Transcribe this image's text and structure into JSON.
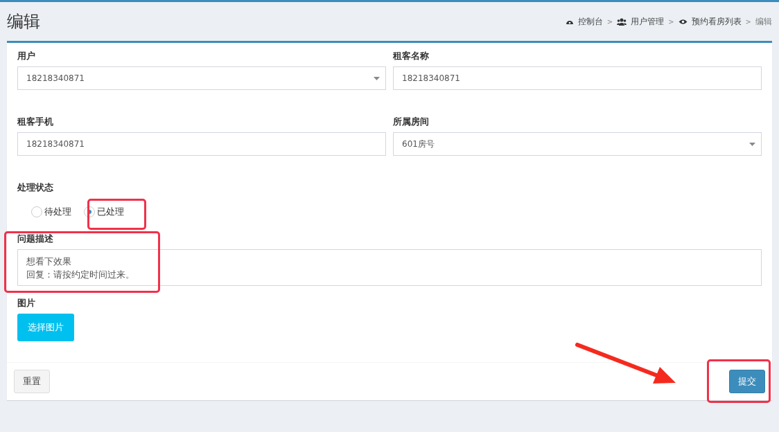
{
  "page_title": "编辑",
  "breadcrumb": [
    {
      "label": "控制台",
      "kind": "dashboard"
    },
    {
      "label": "用户管理",
      "kind": "users"
    },
    {
      "label": "预约看房列表",
      "kind": "eye"
    },
    {
      "label": "编辑",
      "kind": "current"
    }
  ],
  "breadcrumb_separator": ">",
  "field_rows": [
    [
      {
        "label": "用户",
        "value": "18218340871",
        "kind": "select"
      },
      {
        "label": "租客名称",
        "value": "18218340871",
        "kind": "input"
      }
    ],
    [
      {
        "label": "租客手机",
        "value": "18218340871",
        "kind": "input"
      },
      {
        "label": "所属房间",
        "value": "601房号",
        "kind": "select"
      }
    ]
  ],
  "status": {
    "label": "处理状态",
    "options": [
      {
        "label": "待处理",
        "selected": false
      },
      {
        "label": "已处理",
        "selected": true
      }
    ]
  },
  "description": {
    "label": "问题描述",
    "lines": [
      "想看下效果",
      "回复：请按约定时间过来。"
    ]
  },
  "image": {
    "label": "图片",
    "button": "选择图片"
  },
  "buttons": {
    "reset": "重置",
    "submit": "提交"
  }
}
